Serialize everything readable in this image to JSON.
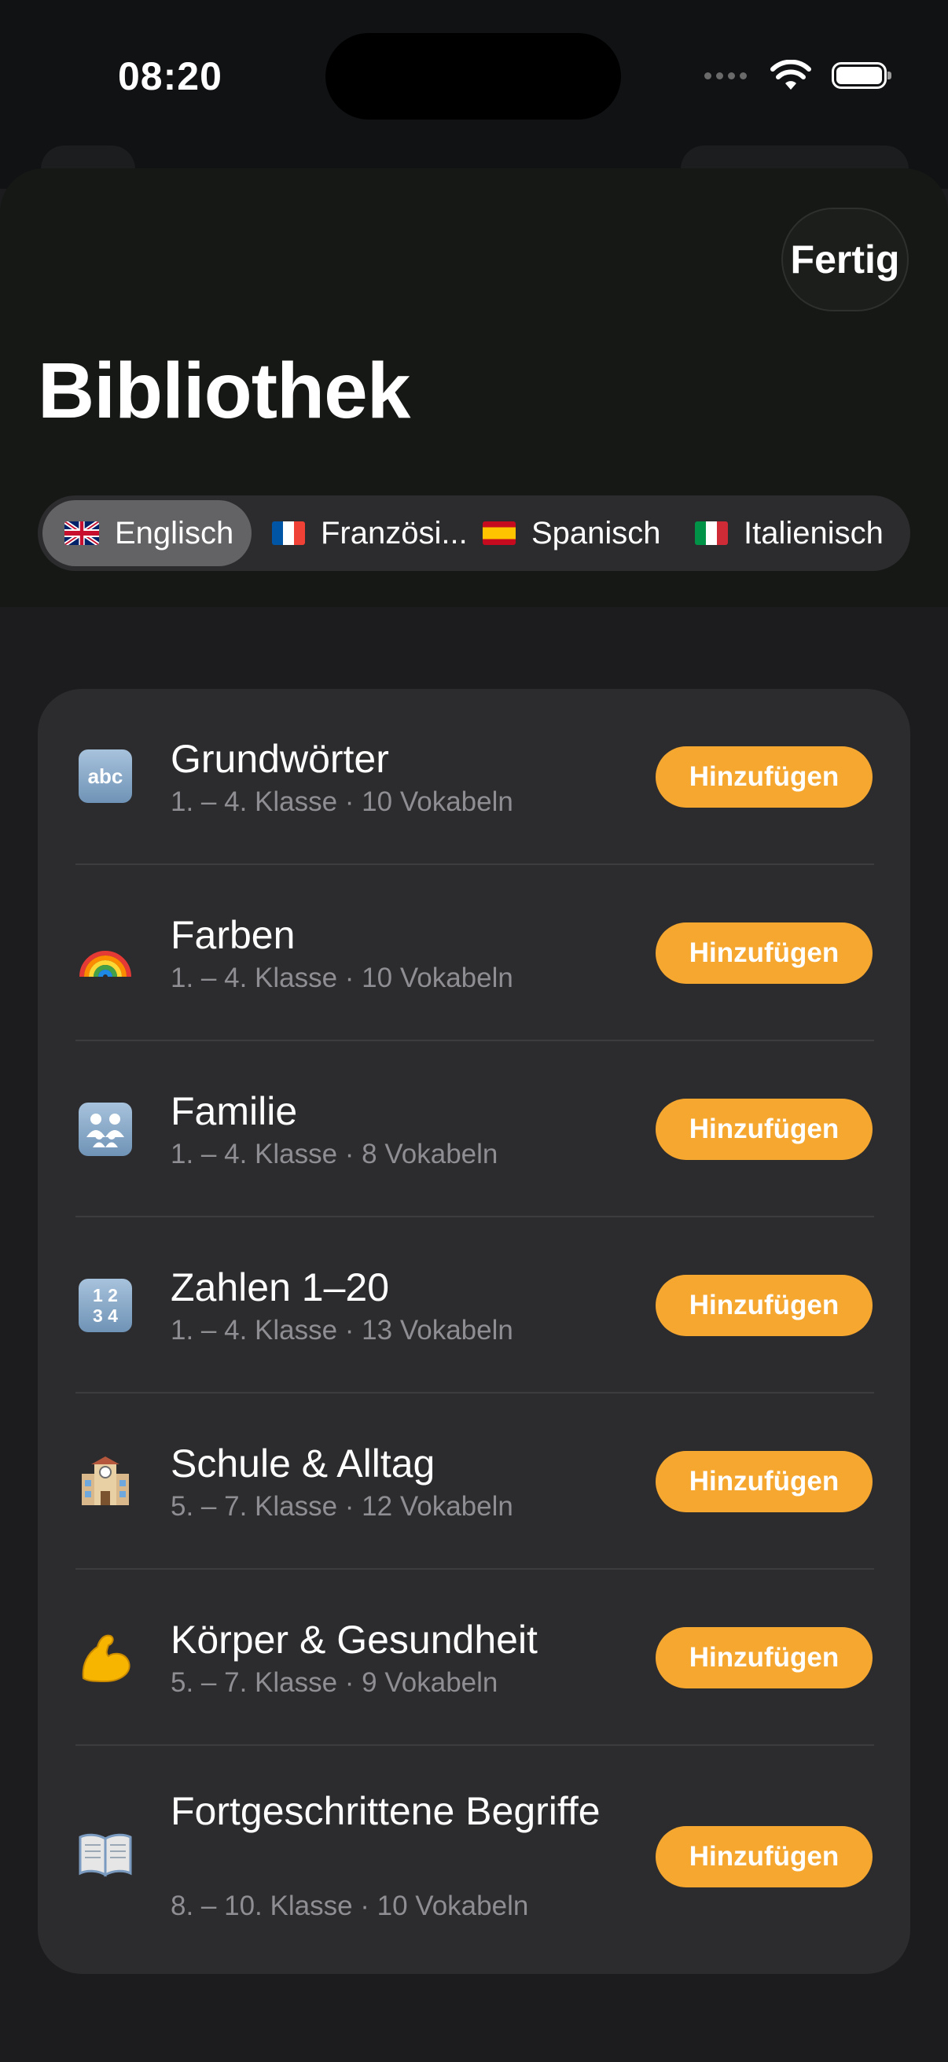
{
  "status_bar": {
    "time": "08:20"
  },
  "header": {
    "title": "Bibliothek",
    "done_label": "Fertig"
  },
  "languages": [
    {
      "label": "Englisch",
      "flag": "uk-flag-icon",
      "selected": true
    },
    {
      "label": "Französi...",
      "flag": "france-flag-icon",
      "selected": false
    },
    {
      "label": "Spanisch",
      "flag": "spain-flag-icon",
      "selected": false
    },
    {
      "label": "Italienisch",
      "flag": "italy-flag-icon",
      "selected": false
    }
  ],
  "decks": [
    {
      "icon": "abc-icon",
      "title": "Grundwörter",
      "subtitle": "1. – 4. Klasse · 10 Vokabeln",
      "action": "Hinzufügen"
    },
    {
      "icon": "rainbow-icon",
      "title": "Farben",
      "subtitle": "1. – 4. Klasse · 10 Vokabeln",
      "action": "Hinzufügen"
    },
    {
      "icon": "family-icon",
      "title": "Familie",
      "subtitle": "1. – 4. Klasse · 8 Vokabeln",
      "action": "Hinzufügen"
    },
    {
      "icon": "numbers-icon",
      "title": "Zahlen 1–20",
      "subtitle": "1. – 4. Klasse · 13 Vokabeln",
      "action": "Hinzufügen"
    },
    {
      "icon": "school-icon",
      "title": "Schule & Alltag",
      "subtitle": "5. – 7. Klasse · 12 Vokabeln",
      "action": "Hinzufügen"
    },
    {
      "icon": "flexed-biceps-icon",
      "title": "Körper & Gesundheit",
      "subtitle": "5. – 7. Klasse · 9 Vokabeln",
      "action": "Hinzufügen"
    },
    {
      "icon": "open-book-icon",
      "title": "Fortgeschrittene Begriffe",
      "subtitle": "8. – 10. Klasse · 10 Vokabeln",
      "action": "Hinzufügen"
    }
  ],
  "colors": {
    "accent": "#f5a730",
    "card": "#2c2c2e",
    "background": "#1c1c1e",
    "secondary_text": "#8e8e93"
  }
}
